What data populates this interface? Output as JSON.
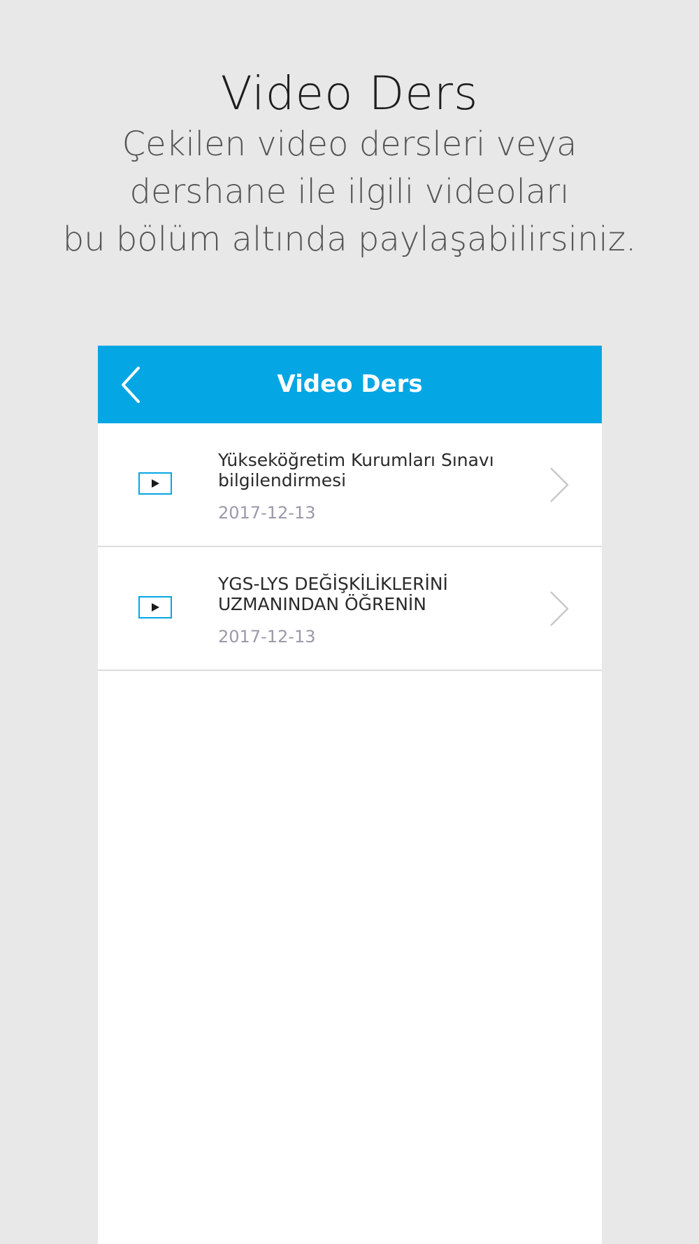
{
  "promo": {
    "title": "Video Ders",
    "subtitle_lines": [
      "Çekilen video dersleri veya",
      "dershane ile ilgili videoları",
      "bu bölüm altında paylaşabilirsiniz."
    ]
  },
  "app": {
    "header": {
      "title": "Video Ders",
      "back_icon": "chevron-left-icon"
    },
    "colors": {
      "header_bg": "#05a6e4",
      "accent": "#05a6e4",
      "date_text": "#9a9aa8"
    },
    "videos": [
      {
        "title": "Yükseköğretim Kurumları Sınavı bilgilendirmesi",
        "date": "2017-12-13",
        "icon": "video-play-icon"
      },
      {
        "title": "YGS-LYS DEĞİŞKİLİKLERİNİ UZMANINDAN ÖĞRENİN",
        "date": "2017-12-13",
        "icon": "video-play-icon"
      }
    ]
  }
}
